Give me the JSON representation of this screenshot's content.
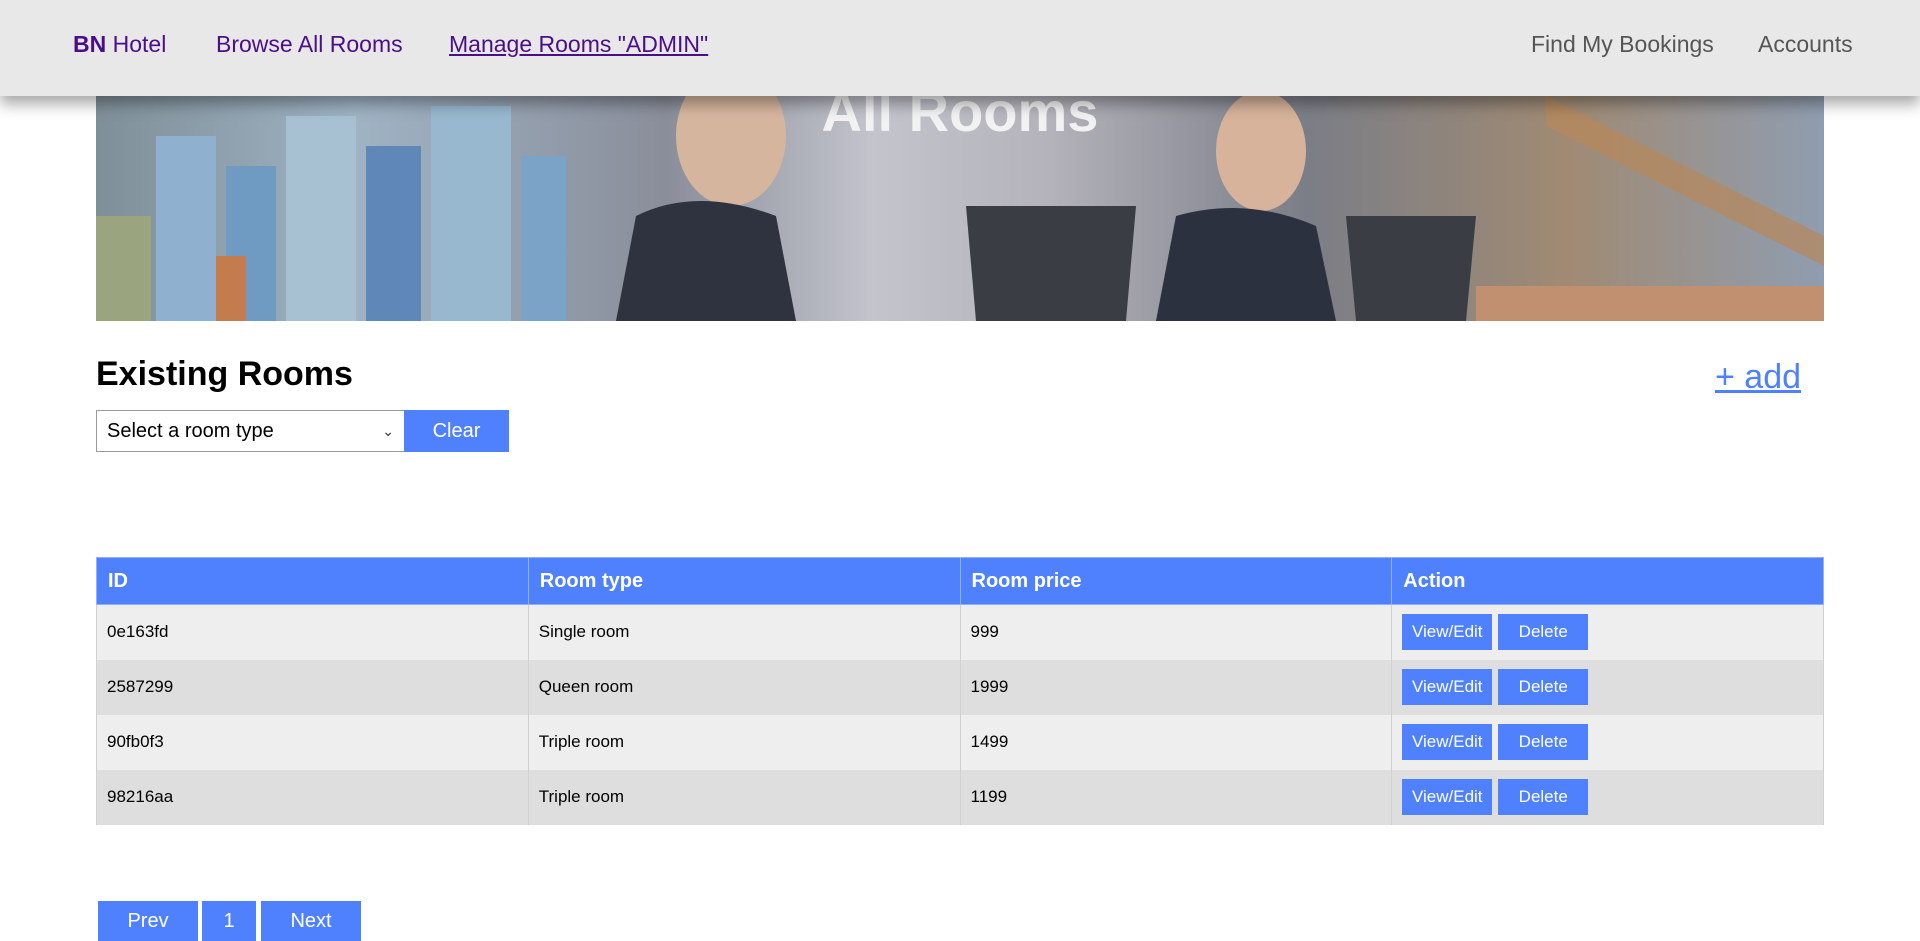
{
  "nav": {
    "brand_bold": "BN",
    "brand_rest": " Hotel",
    "browse": "Browse All Rooms",
    "manage": "Manage Rooms \"ADMIN\"",
    "find": "Find My Bookings",
    "accounts": "Accounts"
  },
  "hero": {
    "title": "All Rooms"
  },
  "section": {
    "title": "Existing Rooms",
    "add_label": "+ add",
    "select_value": "Select a room type",
    "clear_label": "Clear"
  },
  "table": {
    "headers": [
      "ID",
      "Room type",
      "Room price",
      "Action"
    ],
    "rows": [
      {
        "id": "0e163fd",
        "type": "Single room",
        "price": "999"
      },
      {
        "id": "2587299",
        "type": "Queen room",
        "price": "1999"
      },
      {
        "id": "90fb0f3",
        "type": "Triple room",
        "price": "1499"
      },
      {
        "id": "98216aa",
        "type": "Triple room",
        "price": "1199"
      }
    ],
    "view_label": "View/Edit",
    "delete_label": "Delete"
  },
  "pagination": {
    "prev": "Prev",
    "page": "1",
    "next": "Next"
  },
  "colors": {
    "accent": "#4f81ff",
    "nav_link": "#4b0e8a",
    "navbar_bg": "#e8e8e8"
  }
}
